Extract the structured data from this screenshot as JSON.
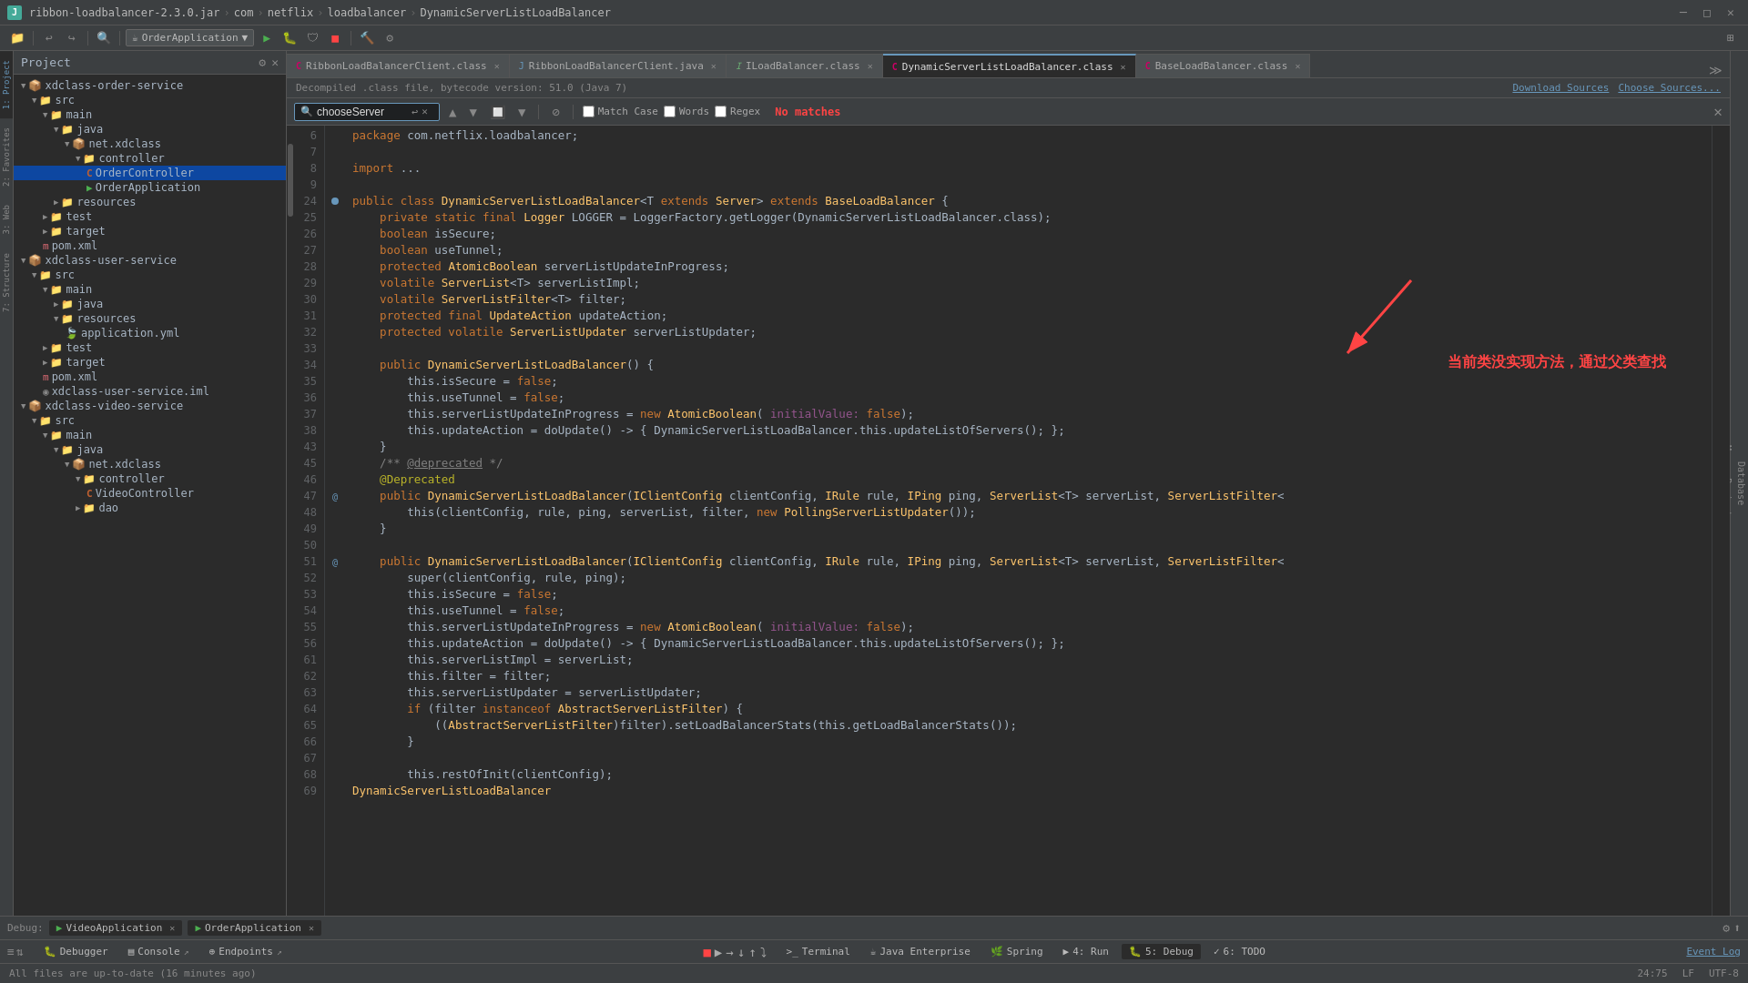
{
  "titleBar": {
    "jarName": "ribbon-loadbalancer-2.3.0.jar",
    "segments": [
      "com",
      "netflix",
      "loadbalancer",
      "DynamicServerListLoadBalancer"
    ]
  },
  "toolbar": {
    "appSelector": "OrderApplication",
    "runLabel": "▶",
    "debugLabel": "🐛",
    "stopLabel": "■"
  },
  "tabs": [
    {
      "label": "RibbonLoadBalancerClient.class",
      "type": "class",
      "active": false
    },
    {
      "label": "RibbonLoadBalancerClient.java",
      "type": "java",
      "active": false
    },
    {
      "label": "ILoadBalancer.class",
      "type": "class",
      "active": false
    },
    {
      "label": "DynamicServerListLoadBalancer.class",
      "type": "class",
      "active": true
    },
    {
      "label": "BaseLoadBalancer.class",
      "type": "class",
      "active": false
    }
  ],
  "infoBar": {
    "text": "Decompiled .class file, bytecode version: 51.0 (Java 7)",
    "downloadSources": "Download Sources",
    "chooseSources": "Choose Sources..."
  },
  "searchBar": {
    "query": "chooseServer",
    "matchCase": "Match Case",
    "words": "Words",
    "regex": "Regex",
    "noMatches": "No matches"
  },
  "projectTree": {
    "header": "Project",
    "items": [
      {
        "label": "xdclass-order-service",
        "indent": 0,
        "type": "module",
        "expanded": true
      },
      {
        "label": "src",
        "indent": 1,
        "type": "folder",
        "expanded": true
      },
      {
        "label": "main",
        "indent": 2,
        "type": "folder",
        "expanded": true
      },
      {
        "label": "java",
        "indent": 3,
        "type": "folder",
        "expanded": true
      },
      {
        "label": "net.xdclass",
        "indent": 4,
        "type": "package",
        "expanded": true
      },
      {
        "label": "controller",
        "indent": 5,
        "type": "folder",
        "expanded": true
      },
      {
        "label": "OrderController",
        "indent": 6,
        "type": "java",
        "selected": true
      },
      {
        "label": "OrderApplication",
        "indent": 6,
        "type": "app"
      },
      {
        "label": "resources",
        "indent": 3,
        "type": "folder"
      },
      {
        "label": "test",
        "indent": 2,
        "type": "folder"
      },
      {
        "label": "target",
        "indent": 2,
        "type": "folder"
      },
      {
        "label": "pom.xml",
        "indent": 2,
        "type": "xml"
      },
      {
        "label": "xdclass-user-service",
        "indent": 0,
        "type": "module",
        "expanded": true
      },
      {
        "label": "src",
        "indent": 1,
        "type": "folder",
        "expanded": true
      },
      {
        "label": "main",
        "indent": 2,
        "type": "folder",
        "expanded": true
      },
      {
        "label": "java",
        "indent": 3,
        "type": "folder"
      },
      {
        "label": "resources",
        "indent": 3,
        "type": "folder",
        "expanded": true
      },
      {
        "label": "application.yml",
        "indent": 4,
        "type": "yml"
      },
      {
        "label": "test",
        "indent": 2,
        "type": "folder"
      },
      {
        "label": "target",
        "indent": 2,
        "type": "folder"
      },
      {
        "label": "pom.xml",
        "indent": 2,
        "type": "xml"
      },
      {
        "label": "xdclass-user-service.iml",
        "indent": 2,
        "type": "iml"
      },
      {
        "label": "xdclass-video-service",
        "indent": 0,
        "type": "module",
        "expanded": true
      },
      {
        "label": "src",
        "indent": 1,
        "type": "folder",
        "expanded": true
      },
      {
        "label": "main",
        "indent": 2,
        "type": "folder",
        "expanded": true
      },
      {
        "label": "java",
        "indent": 3,
        "type": "folder",
        "expanded": true
      },
      {
        "label": "net.xdclass",
        "indent": 4,
        "type": "package",
        "expanded": true
      },
      {
        "label": "controller",
        "indent": 5,
        "type": "folder",
        "expanded": true
      },
      {
        "label": "VideoController",
        "indent": 6,
        "type": "java"
      },
      {
        "label": "dao",
        "indent": 5,
        "type": "folder"
      }
    ]
  },
  "codeLines": [
    {
      "num": 6,
      "code": "    package com.netflix.loadbalancer;"
    },
    {
      "num": 7,
      "code": ""
    },
    {
      "num": 8,
      "code": "    import ..."
    },
    {
      "num": 9,
      "code": ""
    },
    {
      "num": 24,
      "code": "    public class DynamicServerListLoadBalancer<T extends Server> extends BaseLoadBalancer {"
    },
    {
      "num": 25,
      "code": "        private static final Logger LOGGER = LoggerFactory.getLogger(DynamicServerListLoadBalancer.class);"
    },
    {
      "num": 26,
      "code": "        boolean isSecure;"
    },
    {
      "num": 27,
      "code": "        boolean useTunnel;"
    },
    {
      "num": 28,
      "code": "        protected AtomicBoolean serverListUpdateInProgress;"
    },
    {
      "num": 29,
      "code": "        volatile ServerList<T> serverListImpl;"
    },
    {
      "num": 30,
      "code": "        volatile ServerListFilter<T> filter;"
    },
    {
      "num": 31,
      "code": "        protected final UpdateAction updateAction;"
    },
    {
      "num": 32,
      "code": "        protected volatile ServerListUpdater serverListUpdater;"
    },
    {
      "num": 33,
      "code": ""
    },
    {
      "num": 34,
      "code": "        public DynamicServerListLoadBalancer() {"
    },
    {
      "num": 35,
      "code": "            this.isSecure = false;"
    },
    {
      "num": 36,
      "code": "            this.useTunnel = false;"
    },
    {
      "num": 37,
      "code": "            this.serverListUpdateInProgress = new AtomicBoolean( initialValue: false);"
    },
    {
      "num": 38,
      "code": "            this.updateAction = doUpdate() -> { DynamicServerListLoadBalancer.this.updateListOfServers(); };"
    },
    {
      "num": 43,
      "code": "        }"
    },
    {
      "num": 45,
      "code": "        /** @deprecated */"
    },
    {
      "num": 46,
      "code": "        @Deprecated"
    },
    {
      "num": 47,
      "code": "        public DynamicServerListLoadBalancer(IClientConfig clientConfig, IRule rule, IPing ping, ServerList<T> serverList, ServerListFilter<"
    },
    {
      "num": 48,
      "code": "            this(clientConfig, rule, ping, serverList, filter, new PollingServerListUpdater());"
    },
    {
      "num": 49,
      "code": "        }"
    },
    {
      "num": 50,
      "code": ""
    },
    {
      "num": 51,
      "code": "        public DynamicServerListLoadBalancer(IClientConfig clientConfig, IRule rule, IPing ping, ServerList<T> serverList, ServerListFilter<"
    },
    {
      "num": 52,
      "code": "            super(clientConfig, rule, ping);"
    },
    {
      "num": 53,
      "code": "            this.isSecure = false;"
    },
    {
      "num": 54,
      "code": "            this.useTunnel = false;"
    },
    {
      "num": 55,
      "code": "            this.serverListUpdateInProgress = new AtomicBoolean( initialValue: false);"
    },
    {
      "num": 56,
      "code": "            this.updateAction = doUpdate() -> { DynamicServerListLoadBalancer.this.updateListOfServers(); };"
    },
    {
      "num": 61,
      "code": "            this.serverListImpl = serverList;"
    },
    {
      "num": 62,
      "code": "            this.filter = filter;"
    },
    {
      "num": 63,
      "code": "            this.serverListUpdater = serverListUpdater;"
    },
    {
      "num": 64,
      "code": "            if (filter instanceof AbstractServerListFilter) {"
    },
    {
      "num": 65,
      "code": "                ((AbstractServerListFilter)filter).setLoadBalancerStats(this.getLoadBalancerStats());"
    },
    {
      "num": 66,
      "code": "            }"
    },
    {
      "num": 67,
      "code": ""
    },
    {
      "num": 68,
      "code": "            this.restOfInit(clientConfig);"
    },
    {
      "num": 69,
      "code": "    DynamicServerListLoadBalancer"
    }
  ],
  "annotation": {
    "text": "当前类没实现方法，通过父类查找"
  },
  "bottomTabs": {
    "debugLabel": "Debug:",
    "apps": [
      {
        "label": "VideoApplication",
        "active": false
      },
      {
        "label": "OrderApplication",
        "active": false
      }
    ]
  },
  "toolTabs": [
    {
      "label": "Debugger",
      "icon": "🐛"
    },
    {
      "label": "Console",
      "icon": "▤"
    },
    {
      "label": "Endpoints",
      "icon": "⊕"
    },
    {
      "label": "",
      "icon": "→"
    }
  ],
  "bottomTools": [
    {
      "label": "Terminal",
      "icon": ">_"
    },
    {
      "label": "Java Enterprise",
      "icon": "☕"
    },
    {
      "label": "Spring",
      "icon": "🌿"
    },
    {
      "label": "4: Run",
      "icon": "▶"
    },
    {
      "label": "5: Debug",
      "icon": "🐛",
      "active": true
    },
    {
      "label": "6: TODO",
      "icon": "✓"
    }
  ],
  "statusBar": {
    "leftText": "All files are up-to-date (16 minutes ago)",
    "position": "24:75",
    "lineEnding": "LF",
    "encoding": "UTF-8"
  },
  "rightLabels": [
    {
      "label": "Database"
    },
    {
      "label": "Maven Projects"
    },
    {
      "label": "Ant Build"
    }
  ],
  "leftLabels": [
    {
      "label": "1: Project",
      "active": true
    },
    {
      "label": "2: Favorites"
    },
    {
      "label": "3: Web"
    },
    {
      "label": "7: Structure"
    }
  ]
}
